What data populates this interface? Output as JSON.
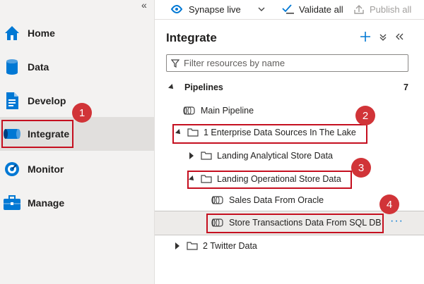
{
  "sidebar": {
    "collapse_glyph": "«",
    "items": [
      {
        "label": "Home",
        "icon": "home-icon"
      },
      {
        "label": "Data",
        "icon": "database-icon"
      },
      {
        "label": "Develop",
        "icon": "document-icon"
      },
      {
        "label": "Integrate",
        "icon": "pipeline-icon"
      },
      {
        "label": "Monitor",
        "icon": "gauge-icon"
      },
      {
        "label": "Manage",
        "icon": "toolbox-icon"
      }
    ]
  },
  "toolbar": {
    "workspace": "Synapse live",
    "validate": "Validate all",
    "publish": "Publish all"
  },
  "panel": {
    "title": "Integrate",
    "search_placeholder": "Filter resources by name",
    "section_label": "Pipelines",
    "section_count": "7"
  },
  "tree": {
    "main_pipeline": "Main Pipeline",
    "folder_enterprise": "1 Enterprise Data Sources In The Lake",
    "folder_landing_analytical": "Landing Analytical Store Data",
    "folder_landing_operational": "Landing Operational Store Data",
    "pipeline_sales": "Sales Data From Oracle",
    "pipeline_store": "Store Transactions Data From SQL DB",
    "folder_twitter": "2 Twitter Data",
    "more_glyph": "···"
  },
  "callouts": [
    "1",
    "2",
    "3",
    "4"
  ],
  "colors": {
    "accent": "#0078d4",
    "callout": "#d13438",
    "highlight": "#c50f1f"
  }
}
